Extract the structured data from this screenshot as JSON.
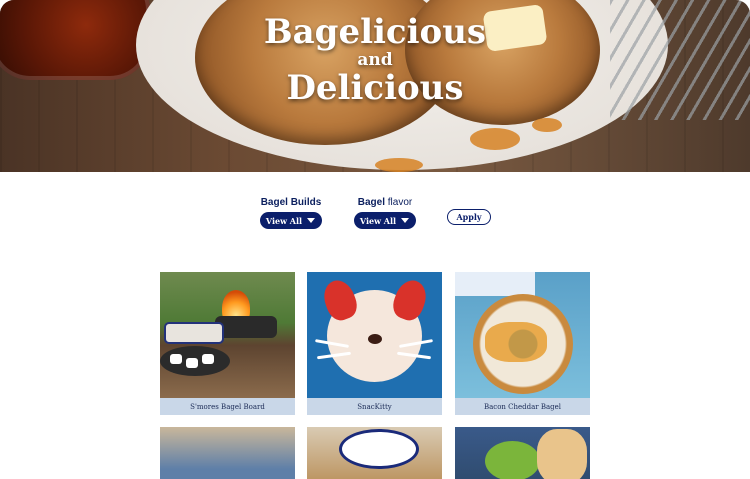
{
  "hero": {
    "title_line1": "Bagelicious",
    "title_line2": "and",
    "title_line3": "Delicious"
  },
  "filters": {
    "builds": {
      "label_bold": "Bagel Builds",
      "value": "View All"
    },
    "flavor": {
      "label_bold": "Bagel",
      "label_thin": "flavor",
      "value": "View All"
    },
    "apply_label": "Apply"
  },
  "recipes": [
    {
      "caption": "S'mores Bagel Board"
    },
    {
      "caption": "SnacKitty"
    },
    {
      "caption": "Bacon Cheddar Bagel"
    },
    {
      "caption": ""
    },
    {
      "caption": ""
    },
    {
      "caption": ""
    }
  ],
  "colors": {
    "brand_navy": "#0b1f6b",
    "caption_bg": "#c9d7e8"
  }
}
